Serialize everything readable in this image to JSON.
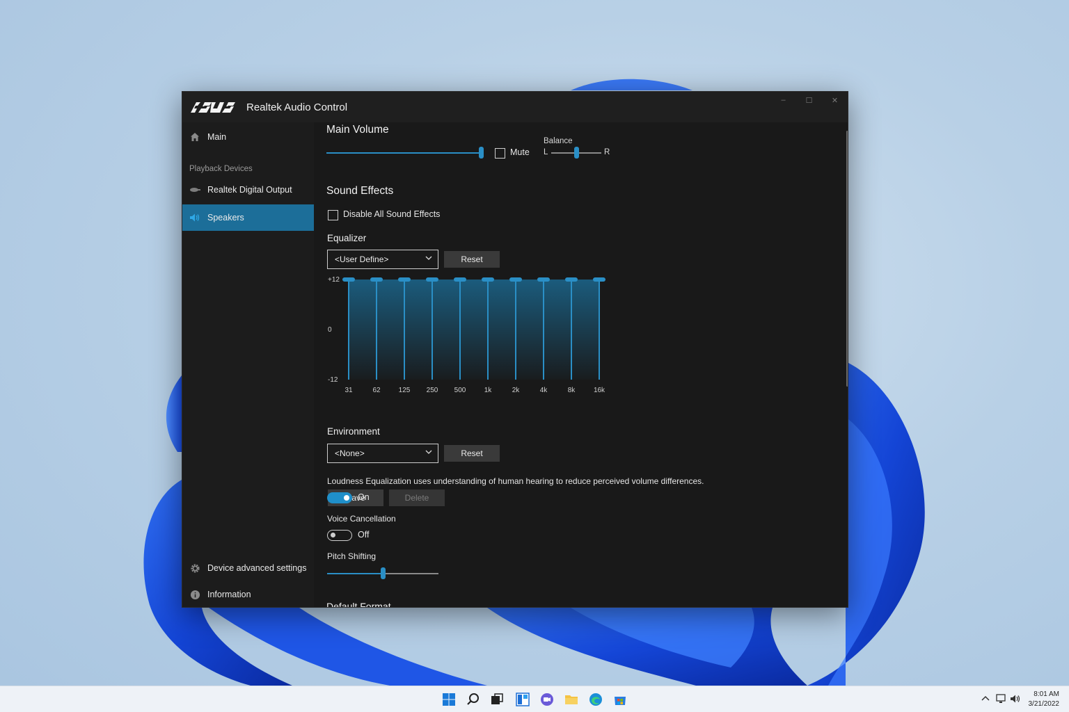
{
  "window": {
    "title": "Realtek Audio Control",
    "brand": "ASUS",
    "controls": {
      "minimize": "–",
      "maximize": "☐",
      "close": "✕"
    }
  },
  "sidebar": {
    "main": "Main",
    "section_label": "Playback Devices",
    "devices": [
      "Realtek Digital Output",
      "Speakers"
    ],
    "active_device": "Speakers",
    "bottom": [
      "Device advanced settings",
      "Information"
    ]
  },
  "main_volume": {
    "title": "Main Volume",
    "level": 1.0,
    "mute_label": "Mute",
    "mute_checked": false,
    "balance_label": "Balance",
    "balance_left": "L",
    "balance_right": "R",
    "balance": 0.5
  },
  "sound_effects": {
    "title": "Sound Effects",
    "disable_all_label": "Disable All Sound Effects",
    "disable_all_checked": false
  },
  "equalizer": {
    "title": "Equalizer",
    "preset": "<User Define>",
    "reset_label": "Reset",
    "save_label": "Save",
    "delete_label": "Delete",
    "y_labels": [
      "+12",
      "0",
      "-12"
    ],
    "bands": [
      "31",
      "62",
      "125",
      "250",
      "500",
      "1k",
      "2k",
      "4k",
      "8k",
      "16k"
    ],
    "gains_db": [
      12,
      12,
      12,
      12,
      12,
      12,
      12,
      12,
      12,
      12
    ],
    "accent": "#2a8fc6"
  },
  "environment": {
    "title": "Environment",
    "preset": "<None>",
    "reset_label": "Reset"
  },
  "loudness": {
    "description": "Loudness Equalization uses understanding of human hearing to reduce perceived volume differences.",
    "state_label": "On",
    "enabled": true
  },
  "voice_cancellation": {
    "title": "Voice Cancellation",
    "state_label": "Off",
    "enabled": false
  },
  "pitch_shifting": {
    "title": "Pitch Shifting",
    "level": 0.5
  },
  "default_format": {
    "title": "Default Format"
  },
  "taskbar": {
    "icons": [
      "windows-start-icon",
      "search-icon",
      "task-view-icon",
      "widgets-icon",
      "chat-icon",
      "file-explorer-icon",
      "edge-icon",
      "store-icon"
    ],
    "time": "8:01 AM",
    "date": "3/21/2022"
  }
}
